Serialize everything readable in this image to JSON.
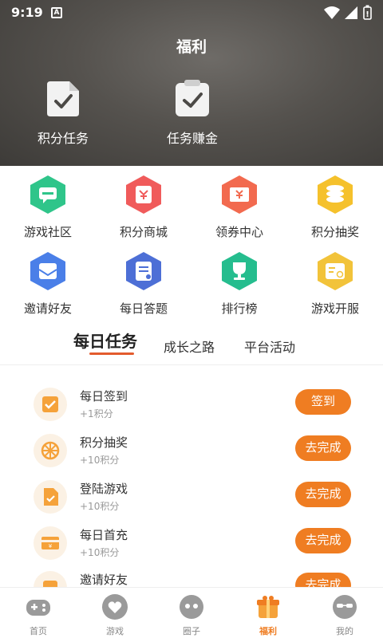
{
  "status_bar": {
    "time": "9:19",
    "app_icon_letter": "A"
  },
  "header": {
    "title": "福利",
    "items": [
      {
        "label": "积分任务",
        "icon": "document-check-icon"
      },
      {
        "label": "任务赚金",
        "icon": "clipboard-check-icon"
      }
    ]
  },
  "grid": [
    {
      "label": "游戏社区",
      "icon": "chat-icon",
      "color": "#2fc58a"
    },
    {
      "label": "积分商城",
      "icon": "shop-icon",
      "color": "#f05b5b"
    },
    {
      "label": "领券中心",
      "icon": "coupon-icon",
      "color": "#f26a4f"
    },
    {
      "label": "积分抽奖",
      "icon": "coins-icon",
      "color": "#f5c12c"
    },
    {
      "label": "邀请好友",
      "icon": "mail-icon",
      "color": "#4a7fe8"
    },
    {
      "label": "每日答题",
      "icon": "quiz-icon",
      "color": "#4d6fd6"
    },
    {
      "label": "排行榜",
      "icon": "trophy-icon",
      "color": "#25bd8e"
    },
    {
      "label": "游戏开服",
      "icon": "server-icon",
      "color": "#f2c33a"
    }
  ],
  "tabs": [
    {
      "label": "每日任务",
      "active": true
    },
    {
      "label": "成长之路",
      "active": false
    },
    {
      "label": "平台活动",
      "active": false
    }
  ],
  "tasks": [
    {
      "name": "每日签到",
      "points": "+1积分",
      "button": "签到",
      "icon": "checkin-icon"
    },
    {
      "name": "积分抽奖",
      "points": "+10积分",
      "button": "去完成",
      "icon": "wheel-icon"
    },
    {
      "name": "登陆游戏",
      "points": "+10积分",
      "button": "去完成",
      "icon": "login-game-icon"
    },
    {
      "name": "每日首充",
      "points": "+10积分",
      "button": "去完成",
      "icon": "recharge-icon"
    },
    {
      "name": "邀请好友",
      "points": "",
      "button": "去完成",
      "icon": "invite-icon"
    }
  ],
  "bottom_nav": [
    {
      "label": "首页",
      "icon": "gamepad-icon",
      "active": false
    },
    {
      "label": "游戏",
      "icon": "heart-icon",
      "active": false
    },
    {
      "label": "圈子",
      "icon": "chat-bubble-icon",
      "active": false
    },
    {
      "label": "福利",
      "icon": "gift-icon",
      "active": true
    },
    {
      "label": "我的",
      "icon": "profile-icon",
      "active": false
    }
  ],
  "colors": {
    "accent": "#ef7d22",
    "tab_underline": "#e35b2d",
    "header_bg": "#55524e"
  }
}
